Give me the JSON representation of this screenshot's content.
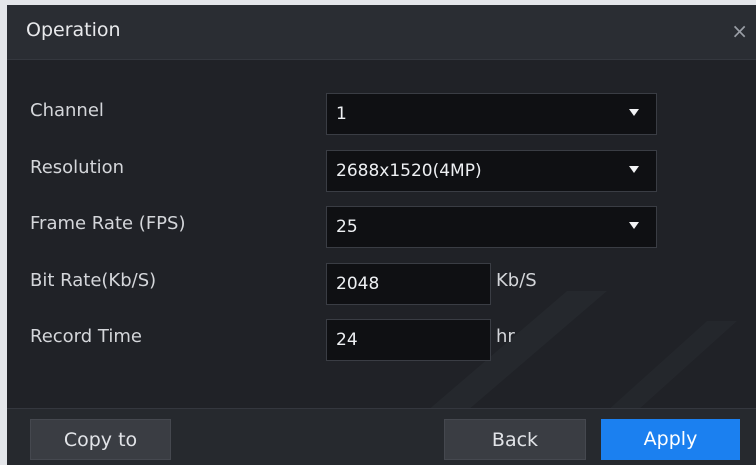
{
  "dialog": {
    "title": "Operation",
    "close_glyph": "×"
  },
  "fields": {
    "channel": {
      "label": "Channel",
      "value": "1"
    },
    "resolution": {
      "label": "Resolution",
      "value": "2688x1520(4MP)"
    },
    "frame_rate": {
      "label": "Frame Rate (FPS)",
      "value": "25"
    },
    "bit_rate": {
      "label": "Bit Rate(Kb/S)",
      "value": "2048",
      "unit": "Kb/S"
    },
    "record_time": {
      "label": "Record Time",
      "value": "24",
      "unit": "hr"
    }
  },
  "footer": {
    "copy_label": "Copy to",
    "back_label": "Back",
    "apply_label": "Apply"
  },
  "icons": {
    "close": "close-icon",
    "dropdown": "caret-down-icon"
  },
  "colors": {
    "accent": "#1b80f0",
    "panel": "#202227",
    "input_bg": "#0f1013"
  }
}
